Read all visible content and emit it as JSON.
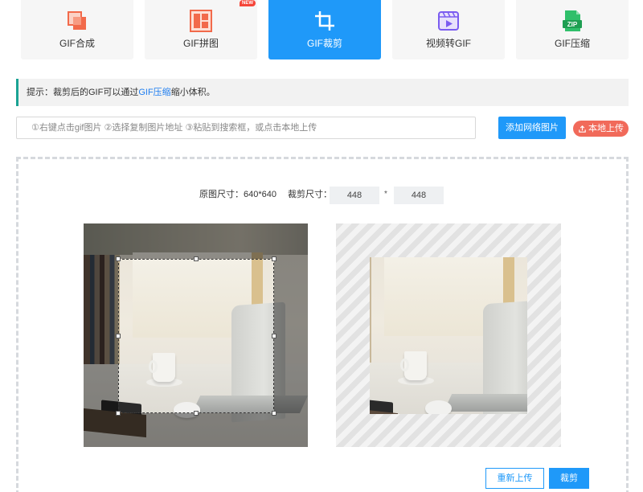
{
  "tabs": [
    {
      "label": "GIF合成",
      "icon": "gif-compose-icon",
      "active": false
    },
    {
      "label": "GIF拼图",
      "icon": "gif-collage-icon",
      "active": false,
      "badge": "NEW"
    },
    {
      "label": "GIF裁剪",
      "icon": "crop-icon",
      "active": true
    },
    {
      "label": "视频转GIF",
      "icon": "video-to-gif-icon",
      "active": false
    },
    {
      "label": "GIF压缩",
      "icon": "zip-compress-icon",
      "active": false,
      "icon_text": "ZIP"
    }
  ],
  "tip": {
    "prefix": "提示：裁剪后的GIF可以通过",
    "link": "GIF压缩",
    "suffix": "缩小体积。"
  },
  "url_input": {
    "placeholder": "①右键点击gif图片 ②选择复制图片地址 ③粘贴到搜索框，或点击本地上传",
    "value": ""
  },
  "buttons": {
    "add_url": "添加网络图片",
    "local_upload": "本地上传",
    "reupload": "重新上传",
    "crop": "裁剪"
  },
  "crop": {
    "original_size_label": "原图尺寸：640*640",
    "crop_size_label": "裁剪尺寸：",
    "width": "448",
    "separator": "*",
    "height": "448"
  },
  "colors": {
    "accent": "#1f99f9",
    "upload_button": "#f16a5a",
    "tip_border": "#1aa394",
    "new_badge": "#f5463a"
  }
}
